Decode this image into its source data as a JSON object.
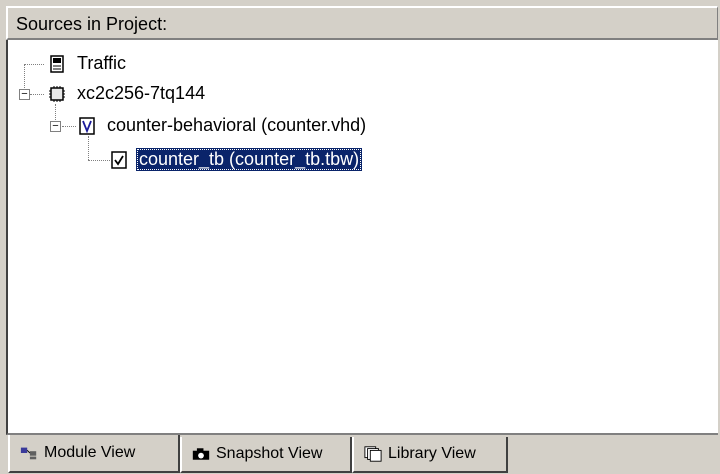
{
  "panel": {
    "title": "Sources in Project:"
  },
  "tree": {
    "items": [
      {
        "label": "Traffic",
        "icon": "document-icon"
      },
      {
        "label": "xc2c256-7tq144",
        "icon": "chip-icon"
      },
      {
        "label": "counter-behavioral (counter.vhd)",
        "icon": "vhdl-file-icon"
      },
      {
        "label": "counter_tb (counter_tb.tbw)",
        "icon": "checked-file-icon",
        "selected": true
      }
    ]
  },
  "tabs": [
    {
      "label": "Module View",
      "icon": "module-view-icon",
      "active": true
    },
    {
      "label": "Snapshot View",
      "icon": "camera-icon"
    },
    {
      "label": "Library View",
      "icon": "library-icon"
    }
  ],
  "colors": {
    "selection": "#0a246a",
    "face": "#d4d0c8"
  }
}
